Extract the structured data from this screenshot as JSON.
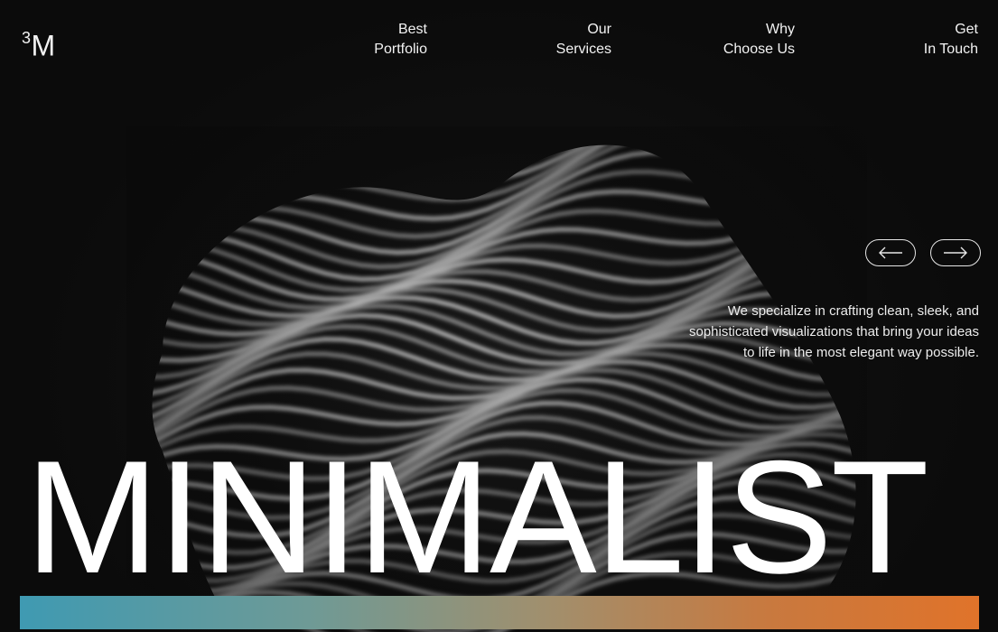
{
  "brand": {
    "logo_superscript": "3",
    "logo_text": "M"
  },
  "nav": {
    "items": [
      {
        "line1": "Best",
        "line2": "Portfolio"
      },
      {
        "line1": "Our",
        "line2": "Services"
      },
      {
        "line1": "Why",
        "line2": "Choose Us"
      },
      {
        "line1": "Get",
        "line2": "In Touch"
      }
    ]
  },
  "carousel": {
    "prev_icon": "arrow-left-icon",
    "next_icon": "arrow-right-icon"
  },
  "hero": {
    "tagline": "We specialize in crafting clean, sleek, and sophisticated visualizations that bring your ideas to life in the most elegant way possible.",
    "headline": "MINIMALIST"
  },
  "colors": {
    "background": "#0b0b0b",
    "text": "#f2f2f2",
    "gradient_start": "#3f9ab2",
    "gradient_end": "#e0732a"
  }
}
